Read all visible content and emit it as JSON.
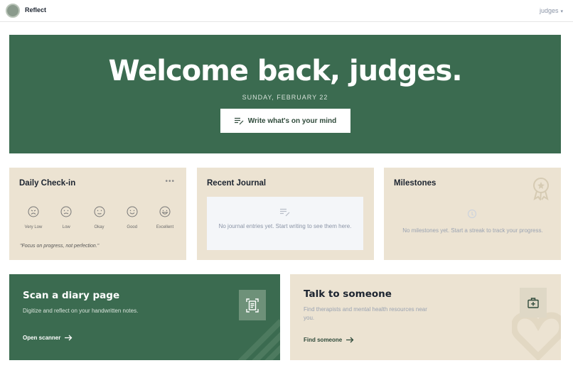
{
  "app": {
    "name": "Reflect",
    "user": "judges"
  },
  "hero": {
    "title": "Welcome back, judges.",
    "date": "SUNDAY, FEBRUARY 22",
    "write_label": "Write what's on your mind"
  },
  "checkin": {
    "title": "Daily Check-in",
    "moods": [
      "Very Low",
      "Low",
      "Okay",
      "Good",
      "Excellent"
    ],
    "quote": "\"Focus on progress, not perfection.\""
  },
  "journal": {
    "title": "Recent Journal",
    "empty": "No journal entries yet. Start writing to see them here."
  },
  "milestones": {
    "title": "Milestones",
    "empty": "No milestones yet. Start a streak to track your progress."
  },
  "scan": {
    "title": "Scan a diary page",
    "subtitle": "Digitize and reflect on your handwritten notes.",
    "link": "Open scanner"
  },
  "talk": {
    "title": "Talk to someone",
    "subtitle": "Find therapists and mental health resources near you.",
    "link": "Find someone"
  },
  "colors": {
    "primary": "#3b6b50",
    "card": "#ece3d2",
    "muted": "#9aa3b2"
  }
}
